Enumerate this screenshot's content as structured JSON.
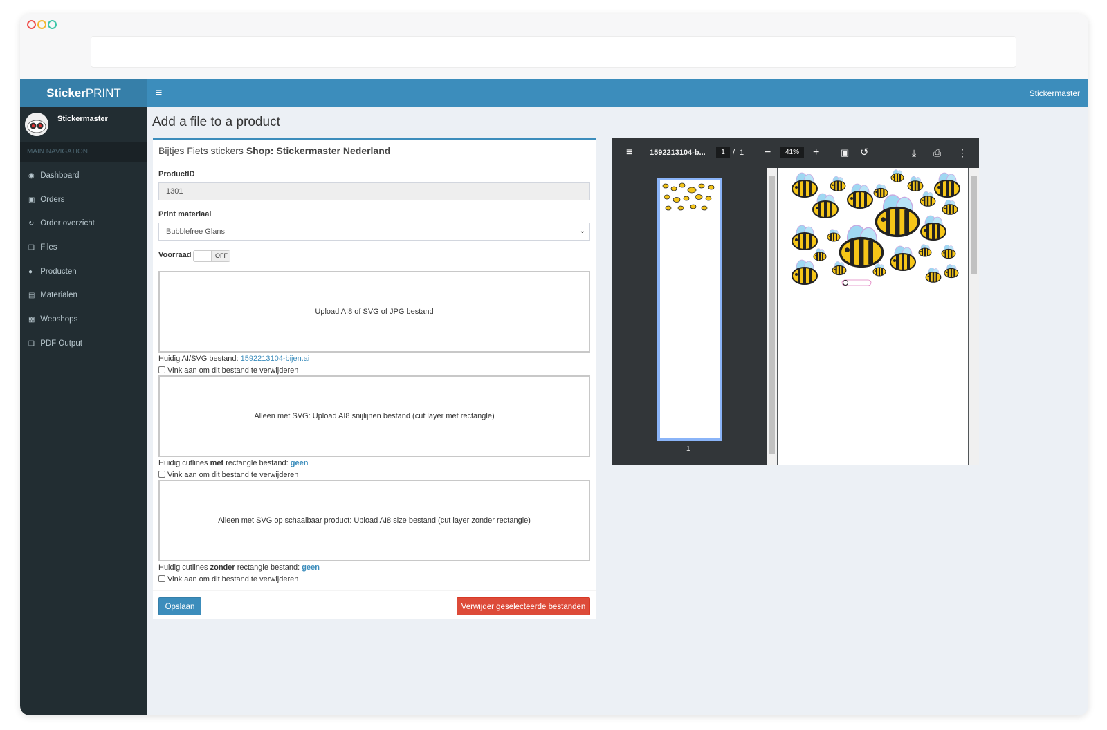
{
  "app": {
    "logo_bold": "Sticker",
    "logo_rest": "PRINT",
    "top_user": "Stickermaster",
    "menu_icon": "hamburger-icon"
  },
  "sidebar": {
    "user_name": "Stickermaster",
    "nav_header": "MAIN NAVIGATION",
    "items": [
      {
        "label": "Dashboard",
        "icon": "dashboard-icon"
      },
      {
        "label": "Orders",
        "icon": "cart-icon"
      },
      {
        "label": "Order overzicht",
        "icon": "refresh-icon"
      },
      {
        "label": "Files",
        "icon": "files-icon"
      },
      {
        "label": "Producten",
        "icon": "globe-icon"
      },
      {
        "label": "Materialen",
        "icon": "id-card-icon"
      },
      {
        "label": "Webshops",
        "icon": "shopping-bag-icon"
      },
      {
        "label": "PDF Output",
        "icon": "files-icon"
      }
    ]
  },
  "page": {
    "title": "Add a file to a product"
  },
  "form": {
    "header_product": "Bijtjes Fiets stickers",
    "header_shop": "Shop: Stickermaster Nederland",
    "productid_label": "ProductID",
    "productid_value": "1301",
    "material_label": "Print materiaal",
    "material_value": "Bubblefree Glans",
    "stock_label": "Voorraad",
    "stock_toggle": "OFF",
    "upload1_text": "Upload AI8 of SVG of JPG bestand",
    "current1_prefix": "Huidig AI/SVG bestand: ",
    "current1_file": "1592213104-bijen.ai",
    "delete_check": "Vink aan om dit bestand te verwijderen",
    "upload2_text": "Alleen met SVG: Upload AI8 snijlijnen bestand (cut layer met rectangle)",
    "current2_a": "Huidig cutlines ",
    "current2_b": "met",
    "current2_c": " rectangle bestand: ",
    "current2_file": "geen",
    "upload3_text": "Alleen met SVG op schaalbaar product: Upload AI8 size bestand (cut layer zonder rectangle)",
    "current3_a": "Huidig cutlines ",
    "current3_b": "zonder",
    "current3_c": " rectangle bestand: ",
    "current3_file": "geen",
    "save_button": "Opslaan",
    "delete_button": "Verwijder geselecteerde bestanden"
  },
  "pdf_viewer": {
    "filename": "1592213104-b...",
    "page_current": "1",
    "page_sep": "/",
    "page_total": "1",
    "zoom": "41%",
    "thumb_page": "1",
    "minus": "−",
    "plus": "+"
  }
}
